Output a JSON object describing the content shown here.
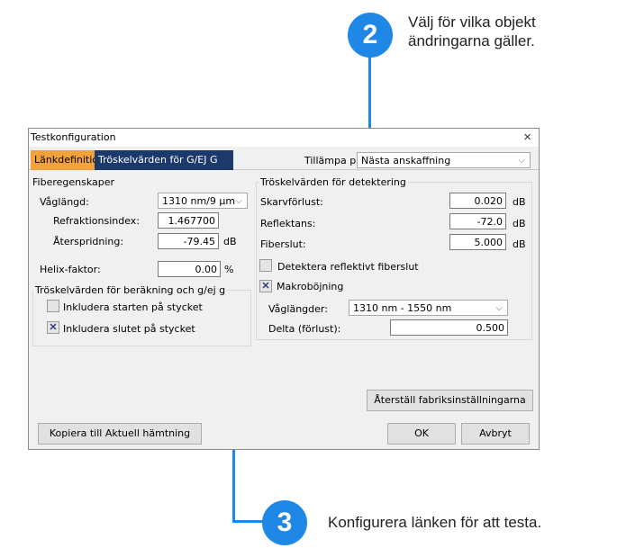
{
  "callouts": [
    {
      "number": "2",
      "text_line1": "Välj för vilka objekt",
      "text_line2": "ändringarna gäller."
    },
    {
      "number": "3",
      "text": "Konfigurera länken för att testa."
    }
  ],
  "window": {
    "title": "Testkonfiguration",
    "close": "×"
  },
  "tabs": [
    {
      "label": "Länkdefinition",
      "active": true
    },
    {
      "label": "Tröskelvärden för G/EJ G",
      "active": false
    }
  ],
  "apply_to": {
    "label": "Tillämpa på:",
    "value": "Nästa anskaffning"
  },
  "fiber": {
    "group_title": "Fiberegenskaper",
    "wavelength_label": "Våglängd:",
    "wavelength_value": "1310 nm/9 µm",
    "refraction_label": "Refraktionsindex:",
    "refraction_value": "1.467700",
    "backscatter_label": "Återspridning:",
    "backscatter_value": "-79.45",
    "backscatter_unit": "dB",
    "helix_label": "Helix-faktor:",
    "helix_value": "0.00",
    "helix_unit": "%"
  },
  "calc_thresholds": {
    "group_title": "Tröskelvärden för beräkning och g/ej g",
    "include_start_label": "Inkludera starten på stycket",
    "include_start_checked": false,
    "include_end_label": "Inkludera slutet på stycket",
    "include_end_checked": true
  },
  "detection": {
    "group_title": "Tröskelvärden för detektering",
    "splice_label": "Skarvförlust:",
    "splice_value": "0.020",
    "reflectance_label": "Reflektans:",
    "reflectance_value": "-72.0",
    "fiber_end_label": "Fiberslut:",
    "fiber_end_value": "5.000",
    "unit": "dB",
    "detect_reflective_label": "Detektera reflektivt fiberslut",
    "detect_reflective_checked": false,
    "macrobend_label": "Makroböjning",
    "macrobend_checked": true,
    "wavelengths_label": "Våglängder:",
    "wavelengths_value": "1310 nm - 1550 nm",
    "delta_label": "Delta (förlust):",
    "delta_value": "0.500"
  },
  "buttons": {
    "reset": "Återställ fabriksinställningarna",
    "copy": "Kopiera till Aktuell hämtning",
    "ok": "OK",
    "cancel": "Avbryt"
  },
  "icons": {
    "check": "✕",
    "chevron": "⌵"
  },
  "colors": {
    "accent_blue": "#1f87e5",
    "active_tab": "#f2a23c",
    "inactive_tab": "#1b3a6b"
  }
}
